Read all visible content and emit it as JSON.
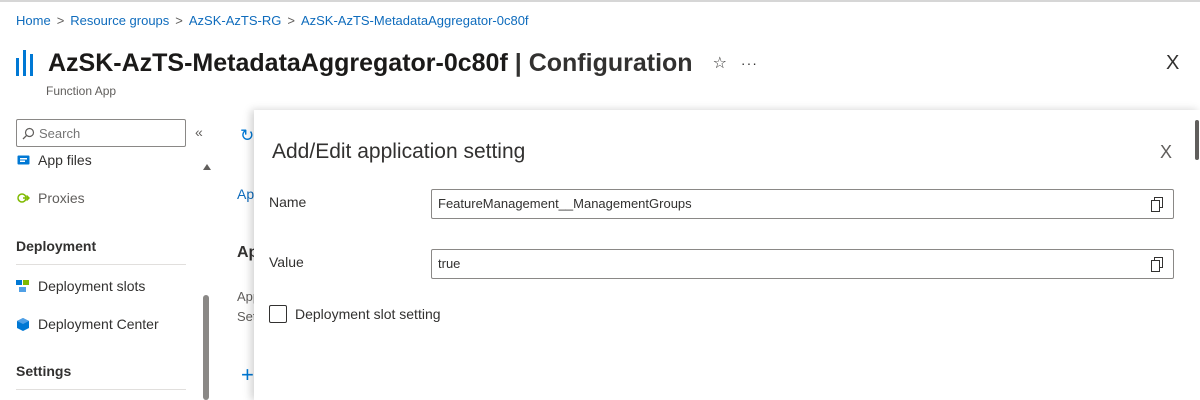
{
  "breadcrumb": {
    "items": [
      "Home",
      "Resource groups",
      "AzSK-AzTS-RG",
      "AzSK-AzTS-MetadataAggregator-0c80f"
    ],
    "separator": ">"
  },
  "header": {
    "resource_name": "AzSK-AzTS-MetadataAggregator-0c80f",
    "divider": "|",
    "page_name": "Configuration",
    "subtitle": "Function App",
    "favorite_glyph": "☆",
    "more_glyph": "···",
    "close_glyph": "X"
  },
  "sidebar": {
    "search_placeholder": "Search",
    "collapse_glyph": "«",
    "items": [
      {
        "label": "App files",
        "icon": "app-files-icon"
      },
      {
        "label": "Proxies",
        "icon": "proxies-icon"
      },
      {
        "section": "Deployment"
      },
      {
        "label": "Deployment slots",
        "icon": "deployment-slots-icon"
      },
      {
        "label": "Deployment Center",
        "icon": "deployment-center-icon"
      },
      {
        "section": "Settings"
      }
    ]
  },
  "middle": {
    "refresh_glyph": "↻",
    "tab": "App",
    "heading": "Ap",
    "text1": "App",
    "text2": "Set",
    "plus_glyph": "+"
  },
  "panel": {
    "title": "Add/Edit application setting",
    "close_glyph": "X",
    "name_label": "Name",
    "name_value": "FeatureManagement__ManagementGroups",
    "value_label": "Value",
    "value_value": "true",
    "slot_setting_label": "Deployment slot setting",
    "slot_setting_checked": false
  },
  "colors": {
    "accent": "#0078d4",
    "link": "#0f6cbd",
    "text": "#323130"
  }
}
